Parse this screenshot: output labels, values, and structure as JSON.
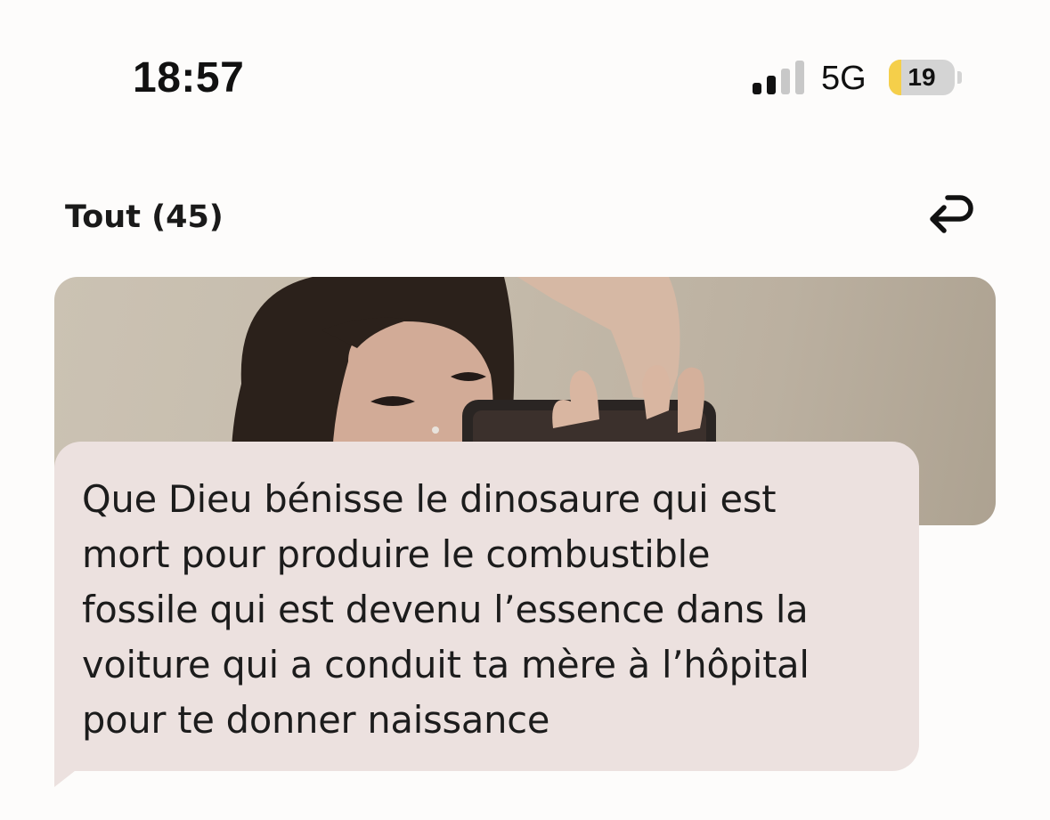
{
  "status_bar": {
    "time": "18:57",
    "network": "5G",
    "signal_bars_active": 2,
    "signal_bars_total": 4,
    "battery_level": "19"
  },
  "header": {
    "filter_label": "Tout (45)",
    "reply_icon": "return-arrow-icon"
  },
  "message": {
    "text": "Que Dieu bénisse le dinosaure qui est\nmort pour produire le combustible\nfossile qui est devenu l’essence dans la\nvoiture qui a conduit ta mère à l’hôpital\npour te donner naissance"
  },
  "colors": {
    "background": "#fdfcfb",
    "bubble": "#ece1df",
    "battery_fill": "#f5cf4a",
    "signal_active": "#111111",
    "signal_inactive": "#c8c8c8"
  }
}
